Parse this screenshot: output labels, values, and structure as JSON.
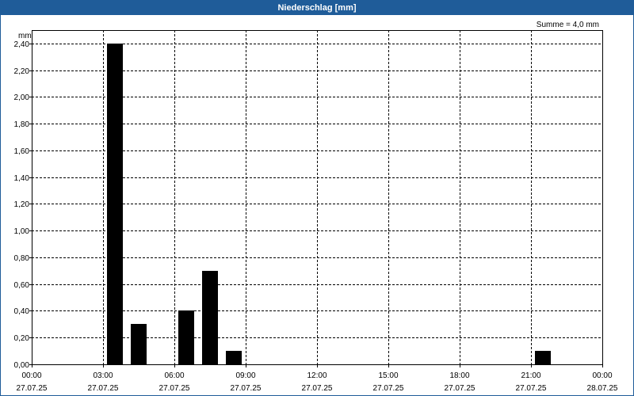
{
  "window": {
    "title": "Niederschlag [mm]"
  },
  "chart_data": {
    "type": "bar",
    "title": "Niederschlag [mm]",
    "ylabel": "mm",
    "xlabel": "",
    "annotation": "Summe = 4,0 mm",
    "ylim": [
      0,
      2.5
    ],
    "yticks": [
      0,
      0.2,
      0.4,
      0.6,
      0.8,
      1.0,
      1.2,
      1.4,
      1.6,
      1.8,
      2.0,
      2.2,
      2.4
    ],
    "ytick_labels": [
      "0,00",
      "0,20",
      "0,40",
      "0,60",
      "0,80",
      "1,00",
      "1,20",
      "1,40",
      "1,60",
      "1,80",
      "2,00",
      "2,20",
      "2,40"
    ],
    "xlim_hours": [
      0,
      24
    ],
    "xticks": [
      {
        "hour": 0,
        "time": "00:00",
        "date": "27.07.25"
      },
      {
        "hour": 3,
        "time": "03:00",
        "date": "27.07.25"
      },
      {
        "hour": 6,
        "time": "06:00",
        "date": "27.07.25"
      },
      {
        "hour": 9,
        "time": "09:00",
        "date": "27.07.25"
      },
      {
        "hour": 12,
        "time": "12:00",
        "date": "27.07.25"
      },
      {
        "hour": 15,
        "time": "15:00",
        "date": "27.07.25"
      },
      {
        "hour": 18,
        "time": "18:00",
        "date": "27.07.25"
      },
      {
        "hour": 21,
        "time": "21:00",
        "date": "27.07.25"
      },
      {
        "hour": 24,
        "time": "00:00",
        "date": "28.07.25"
      }
    ],
    "bars": [
      {
        "hour": 3,
        "value": 2.4
      },
      {
        "hour": 4,
        "value": 0.3
      },
      {
        "hour": 6,
        "value": 0.4
      },
      {
        "hour": 7,
        "value": 0.7
      },
      {
        "hour": 8,
        "value": 0.1
      },
      {
        "hour": 21,
        "value": 0.1
      }
    ],
    "grid": true,
    "bar_color": "#000000"
  }
}
